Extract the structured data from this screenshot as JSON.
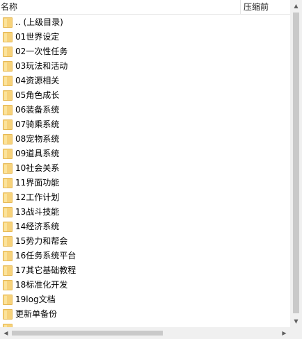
{
  "header": {
    "col_name": "名称",
    "col_compressed": "压缩前"
  },
  "items": [
    {
      "label": ".. (上级目录)",
      "icon": "folder-icon"
    },
    {
      "label": "01世界设定",
      "icon": "folder-icon"
    },
    {
      "label": "02一次性任务",
      "icon": "folder-icon"
    },
    {
      "label": "03玩法和活动",
      "icon": "folder-icon"
    },
    {
      "label": "04资源相关",
      "icon": "folder-icon"
    },
    {
      "label": "05角色成长",
      "icon": "folder-icon"
    },
    {
      "label": "06装备系统",
      "icon": "folder-icon"
    },
    {
      "label": "07骑乘系统",
      "icon": "folder-icon"
    },
    {
      "label": "08宠物系统",
      "icon": "folder-icon"
    },
    {
      "label": "09道具系统",
      "icon": "folder-icon"
    },
    {
      "label": "10社会关系",
      "icon": "folder-icon"
    },
    {
      "label": "11界面功能",
      "icon": "folder-icon"
    },
    {
      "label": "12工作计划",
      "icon": "folder-icon"
    },
    {
      "label": "13战斗技能",
      "icon": "folder-icon"
    },
    {
      "label": "14经济系统",
      "icon": "folder-icon"
    },
    {
      "label": "15势力和帮会",
      "icon": "folder-icon"
    },
    {
      "label": "16任务系统平台",
      "icon": "folder-icon"
    },
    {
      "label": "17其它基础教程",
      "icon": "folder-icon"
    },
    {
      "label": "18标准化开发",
      "icon": "folder-icon"
    },
    {
      "label": "19log文档",
      "icon": "folder-icon"
    },
    {
      "label": "更新单备份",
      "icon": "folder-icon"
    },
    {
      "label": "",
      "icon": "folder-icon"
    }
  ],
  "colors": {
    "folder_fill": "#f7d27a",
    "folder_border": "#e6b955",
    "scrollbar_track": "#f0f0f0",
    "scrollbar_thumb": "#c9c9c9"
  }
}
